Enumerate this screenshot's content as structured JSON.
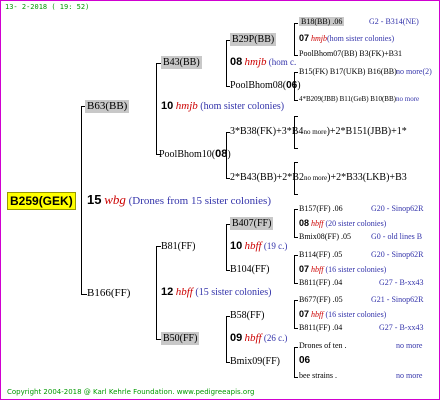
{
  "header": {
    "date": "13- 2-2018 ( 19: 52)"
  },
  "footer": {
    "copyright": "Copyright 2004-2018 @ Karl Kehrle Foundation.   www.pedigreeapis.org"
  },
  "root": {
    "id": "B259(GEK)",
    "num": "15",
    "name": "wbg",
    "note": "(Drones from 15 sister colonies)"
  },
  "g1": {
    "top": {
      "id": "B63(BB)",
      "num": "10",
      "name": "hmjb",
      "note": "(hom sister colonies)"
    },
    "bottom": {
      "id": "B166(FF)",
      "num": "12",
      "name": "hbff",
      "note": "(15 sister colonies)"
    }
  },
  "g2": {
    "b43": {
      "id": "B43(BB)",
      "num": "08",
      "name": "hmjb",
      "note": "(hom c."
    },
    "pool10": {
      "id": "PoolBhom10(",
      "num": "08",
      "close": ")"
    },
    "b81": {
      "id": "B81(FF)",
      "num": "10",
      "name": "hbff",
      "note": "(19 c.)"
    },
    "b50": {
      "id": "B50(FF)",
      "num": "09",
      "name": "hbff",
      "note": "(26 c.)"
    }
  },
  "g3": {
    "b29p": {
      "id": "B29P(BB)",
      "num": "07",
      "name": "hmjb",
      "note": "(hom sister colonies)"
    },
    "pool08": {
      "id": "PoolBhom08(",
      "num": "06",
      "close": ")"
    },
    "f1": {
      "text": "3*B38(FK)+3*B4",
      "small": "no more",
      "rest": ")+2*B151(JBB)+1*"
    },
    "f2": {
      "text": "2*B43(BB)+2*B2",
      "small": "no more",
      "rest": ")+2*B33(LKB)+B3"
    },
    "b407": {
      "id": "B407(FF)",
      "num": "10",
      "name": "hbff",
      "note": "(19 c.)"
    },
    "b104": {
      "id": "B104(FF)"
    },
    "b58": {
      "id": "B58(FF)",
      "num": "07",
      "name": "hbff",
      "note": "(16 sister colonies)"
    },
    "bmix09": {
      "id": "Bmix09(FF)",
      "num": "06"
    }
  },
  "g4": {
    "r1": {
      "a": "B18(BB) .06",
      "b": "G2 - B314(NE)"
    },
    "r2": {
      "num": "07",
      "name": "hmjb",
      "note": "(hom sister colonies)"
    },
    "r3": {
      "a": "PoolBhom07(BB) B3(FK)+B31",
      "b": ""
    },
    "r4": {
      "a": "B15(FK) B17(UKB) B16(BB)",
      "b": "no more(2)"
    },
    "r5": {
      "a": "4*B209(JBB) B11(GeB) B10(BB)",
      "b": "no more"
    },
    "r6": {
      "a": "B157(FF) .06",
      "b": "G20 - Sinop62R"
    },
    "r7": {
      "num": "08",
      "name": "hbff",
      "note": "(20 sister colonies)"
    },
    "r8": {
      "a": "Bmix08(FF) .05",
      "b": "G0 - old lines B"
    },
    "r9": {
      "a": "B114(FF) .05",
      "b": "G20 - Sinop62R"
    },
    "r10": {
      "num": "07",
      "name": "hbff",
      "note": "(16 sister colonies)"
    },
    "r11": {
      "a": "B811(FF) .04",
      "b": "G27 - B-xx43"
    },
    "r12": {
      "a": "B677(FF) .05",
      "b": "G21 - Sinop62R"
    },
    "r13": {
      "num": "07",
      "name": "hbff",
      "note": "(16 sister colonies)"
    },
    "r14": {
      "a": "B811(FF) .04",
      "b": "G27 - B-xx43"
    },
    "r15": {
      "a": "Drones of ten .",
      "b": "no more"
    },
    "r16": {
      "a": "bee strains .",
      "b": "no more"
    }
  },
  "colors": {
    "border": "#d000d0",
    "gray_box": "#c8c8c8",
    "root_box": "#ffff00",
    "name_red": "#cc0000",
    "footer_green": "#009900"
  }
}
